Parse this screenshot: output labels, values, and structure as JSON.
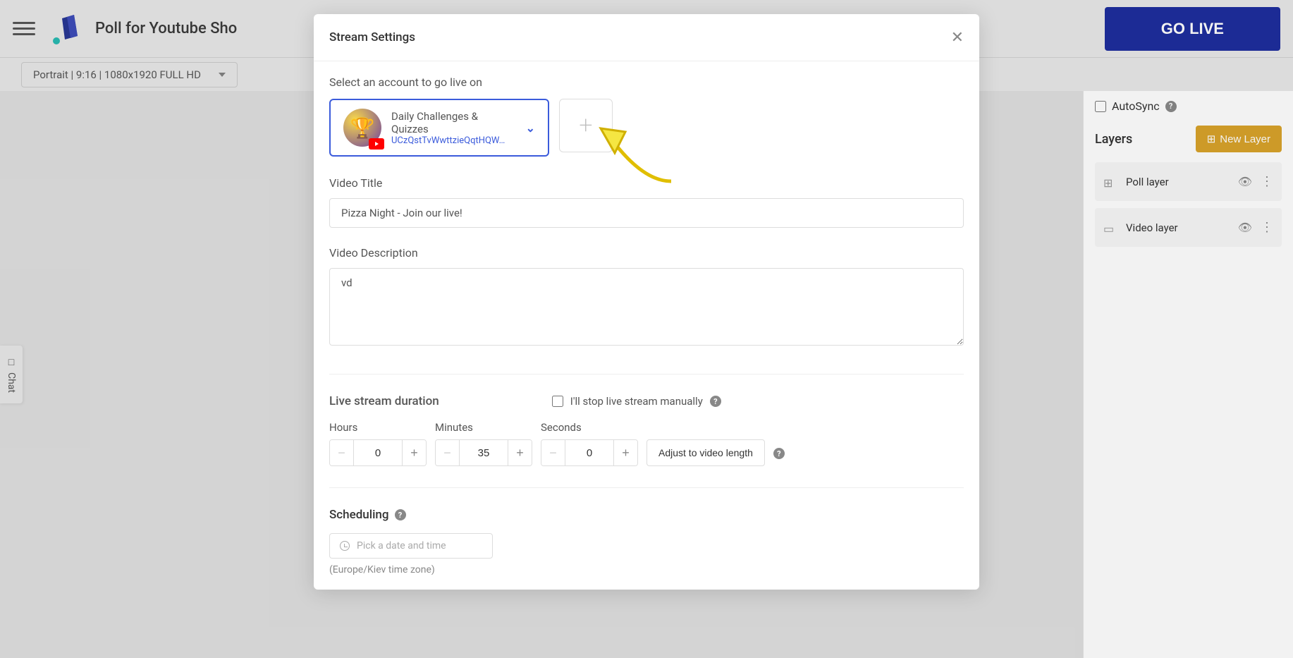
{
  "header": {
    "page_title": "Poll for Youtube Sho",
    "go_live_label": "GO LIVE"
  },
  "sub_header": {
    "resolution": "Portrait | 9:16 | 1080x1920 FULL HD"
  },
  "chat_tab": "Chat",
  "sidebar": {
    "autosync_label": "AutoSync",
    "layers_title": "Layers",
    "new_layer_label": "New Layer",
    "layers": [
      {
        "name": "Poll layer",
        "icon": "grid"
      },
      {
        "name": "Video layer",
        "icon": "video"
      }
    ]
  },
  "modal": {
    "title": "Stream Settings",
    "select_account_label": "Select an account to go live on",
    "account": {
      "name": "Daily Challenges & Quizzes",
      "id": "UCzQstTvWwttzieQqtHQW…"
    },
    "video_title_label": "Video Title",
    "video_title_value": "Pizza Night - Join our live!",
    "video_desc_label": "Video Description",
    "video_desc_value": "vd",
    "duration_label": "Live stream duration",
    "manual_stop_label": "I'll stop live stream manually",
    "hours_label": "Hours",
    "minutes_label": "Minutes",
    "seconds_label": "Seconds",
    "hours_value": "0",
    "minutes_value": "35",
    "seconds_value": "0",
    "adjust_label": "Adjust to video length",
    "scheduling_label": "Scheduling",
    "date_placeholder": "Pick a date and time",
    "timezone": "(Europe/Kiev time zone)"
  }
}
